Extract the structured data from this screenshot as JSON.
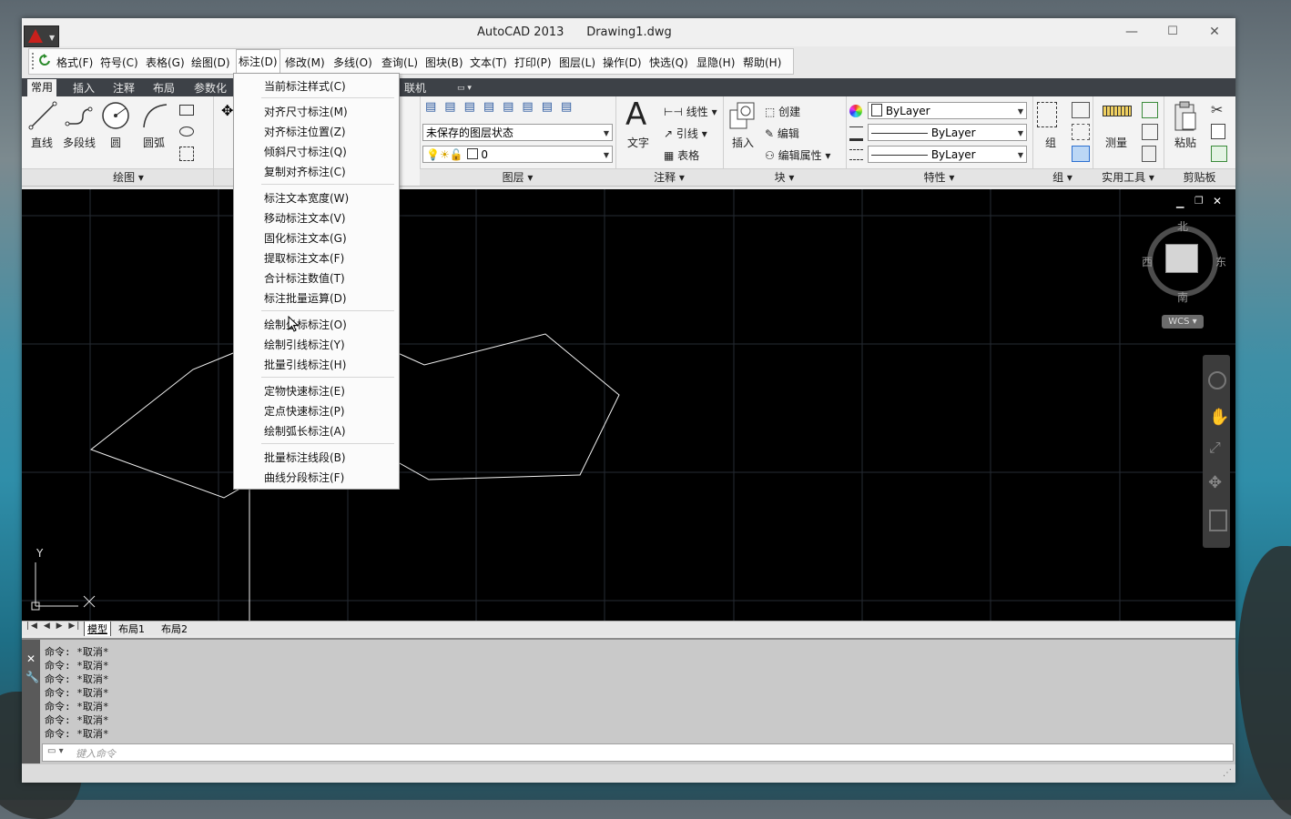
{
  "window": {
    "app_title": "AutoCAD 2013",
    "doc_title": "Drawing1.dwg",
    "minimize": "—",
    "maximize": "☐",
    "close": "✕"
  },
  "menubar": {
    "items": [
      "格式(F)",
      "符号(C)",
      "表格(G)",
      "绘图(D)",
      "标注(D)",
      "修改(M)",
      "多线(O)",
      "查询(L)",
      "图块(B)",
      "文本(T)",
      "打印(P)",
      "图层(L)",
      "操作(D)",
      "快选(Q)",
      "显隐(H)",
      "帮助(H)"
    ]
  },
  "ribbon": {
    "tabs": [
      "常用",
      "插入",
      "注释",
      "布局",
      "参数化",
      "联机"
    ],
    "draw": {
      "line": "直线",
      "polyline": "多段线",
      "circle": "圆",
      "arc": "圆弧",
      "title": "绘图"
    },
    "layers": {
      "state": "未保存的图层状态",
      "current": "0",
      "title": "图层"
    },
    "annotation": {
      "text": "文字",
      "linear": "线性",
      "leader": "引线",
      "table": "表格",
      "title": "注释"
    },
    "block": {
      "insert": "插入",
      "create": "创建",
      "edit": "编辑",
      "edit_attr": "编辑属性",
      "title": "块"
    },
    "properties": {
      "color": "ByLayer",
      "lineweight": "ByLayer",
      "linetype": "ByLayer",
      "title": "特性"
    },
    "group": {
      "label": "组",
      "title": "组"
    },
    "utilities": {
      "measure": "测量",
      "title": "实用工具"
    },
    "clipboard": {
      "paste": "粘贴",
      "title": "剪贴板"
    }
  },
  "dropdown": {
    "groups": [
      [
        "当前标注样式(C)"
      ],
      [
        "对齐尺寸标注(M)",
        "对齐标注位置(Z)",
        "倾斜尺寸标注(Q)",
        "复制对齐标注(C)"
      ],
      [
        "标注文本宽度(W)",
        "移动标注文本(V)",
        "固化标注文本(G)",
        "提取标注文本(F)",
        "合计标注数值(T)",
        "标注批量运算(D)"
      ],
      [
        "绘制坐标标注(O)",
        "绘制引线标注(Y)",
        "批量引线标注(H)"
      ],
      [
        "定物快速标注(E)",
        "定点快速标注(P)",
        "绘制弧长标注(A)"
      ],
      [
        "批量标注线段(B)",
        "曲线分段标注(F)"
      ]
    ]
  },
  "viewcube": {
    "north": "北",
    "south": "南",
    "east": "东",
    "west": "西",
    "wcs": "WCS"
  },
  "ucs": {
    "x": "X",
    "y": "Y"
  },
  "layout_tabs": [
    "模型",
    "布局1",
    "布局2"
  ],
  "command": {
    "history": [
      "命令: *取消*",
      "命令: *取消*",
      "命令: *取消*",
      "命令: *取消*",
      "命令: *取消*",
      "命令: *取消*",
      "命令: *取消*"
    ],
    "placeholder": "键入命令"
  }
}
